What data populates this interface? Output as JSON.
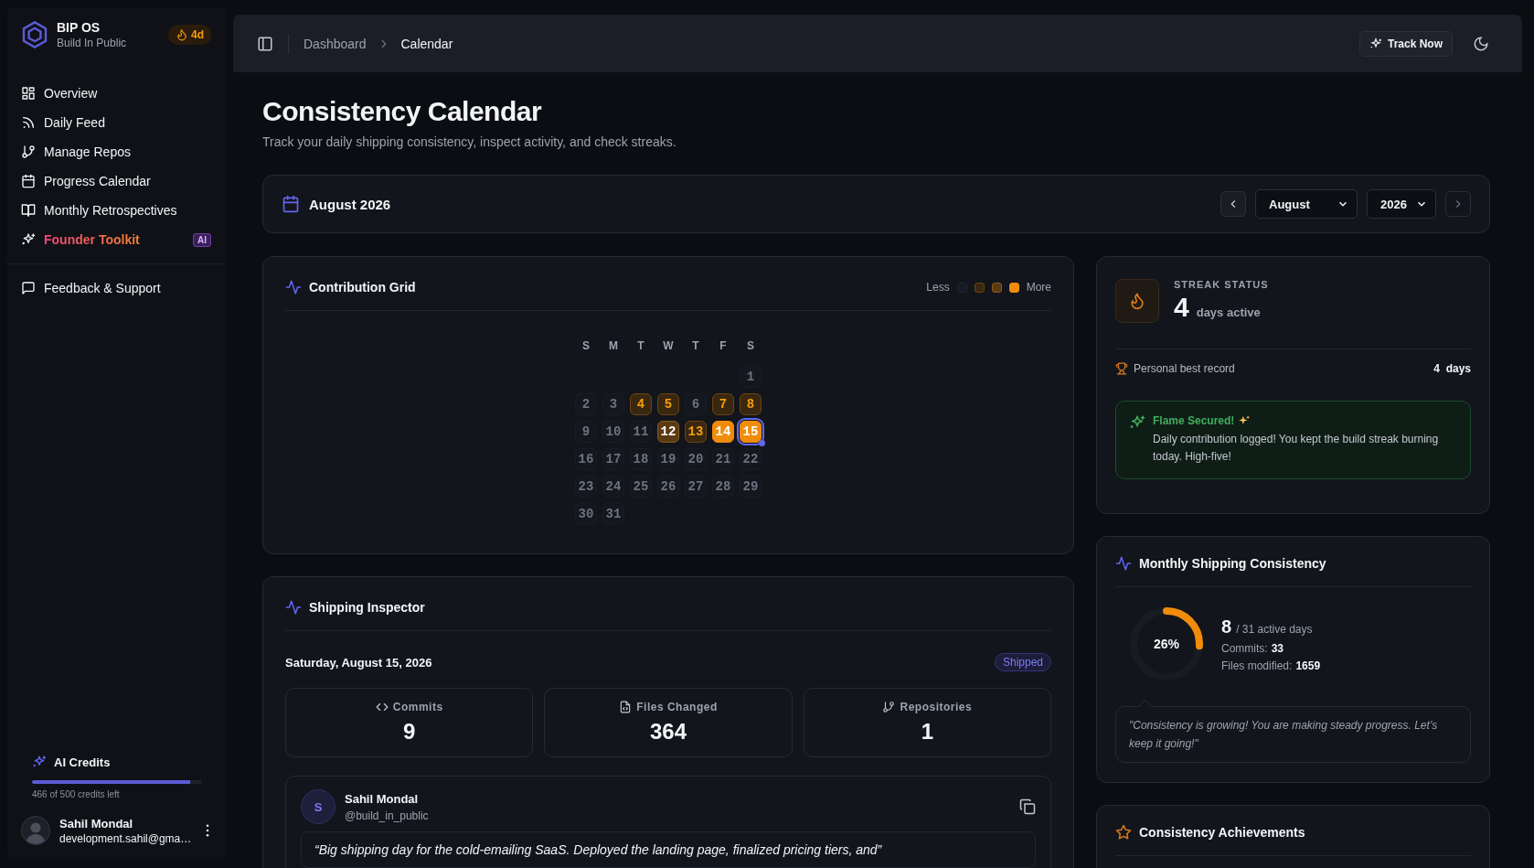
{
  "sidebar": {
    "brand": {
      "name": "BIP OS",
      "tagline": "Build In Public",
      "streak_badge": "4d"
    },
    "nav": [
      {
        "label": "Overview",
        "kind": "normal"
      },
      {
        "label": "Daily Feed",
        "kind": "normal"
      },
      {
        "label": "Manage Repos",
        "kind": "normal"
      },
      {
        "label": "Progress Calendar",
        "kind": "normal"
      },
      {
        "label": "Monthly Retrospectives",
        "kind": "normal"
      },
      {
        "label": "Founder Toolkit",
        "kind": "featured",
        "badge": "AI"
      }
    ],
    "footer_nav": [
      {
        "label": "Feedback & Support"
      }
    ],
    "credits": {
      "title": "AI Credits",
      "level": 0.932,
      "caption": "466 of 500 credits left"
    },
    "user": {
      "name": "Sahil Mondal",
      "email": "development.sahil@gma…"
    }
  },
  "header": {
    "breadcrumbs": [
      {
        "label": "Dashboard",
        "current": false
      },
      {
        "label": "Calendar",
        "current": true
      }
    ],
    "track_button": "Track Now"
  },
  "page": {
    "title": "Consistency Calendar",
    "subtitle": "Track your daily shipping consistency, inspect activity, and check streaks."
  },
  "month_bar": {
    "label": "August 2026",
    "month": "August",
    "year": "2026"
  },
  "contribution": {
    "title": "Contribution Grid",
    "legend": {
      "less": "Less",
      "more": "More",
      "swatches": [
        {
          "kind": "none"
        },
        {
          "kind": "low"
        },
        {
          "kind": "medium"
        },
        {
          "kind": "high"
        }
      ]
    },
    "weekdays": [
      "S",
      "M",
      "T",
      "W",
      "T",
      "F",
      "S"
    ],
    "weeks": [
      [
        {
          "day": "1",
          "kind": "none",
          "selected": false
        }
      ],
      [
        {
          "day": "2",
          "kind": "none",
          "selected": false
        },
        {
          "day": "3",
          "kind": "none",
          "selected": false
        },
        {
          "day": "4",
          "kind": "low",
          "selected": false
        },
        {
          "day": "5",
          "kind": "low",
          "selected": false
        },
        {
          "day": "6",
          "kind": "none",
          "selected": false
        },
        {
          "day": "7",
          "kind": "low",
          "selected": false
        },
        {
          "day": "8",
          "kind": "low",
          "selected": false
        }
      ],
      [
        {
          "day": "9",
          "kind": "none",
          "selected": false
        },
        {
          "day": "10",
          "kind": "none",
          "selected": false
        },
        {
          "day": "11",
          "kind": "none",
          "selected": false
        },
        {
          "day": "12",
          "kind": "medium",
          "selected": false
        },
        {
          "day": "13",
          "kind": "low",
          "selected": false
        },
        {
          "day": "14",
          "kind": "high",
          "selected": false
        },
        {
          "day": "15",
          "kind": "high",
          "selected": true
        }
      ],
      [
        {
          "day": "16",
          "kind": "none",
          "selected": false
        },
        {
          "day": "17",
          "kind": "none",
          "selected": false
        },
        {
          "day": "18",
          "kind": "none",
          "selected": false
        },
        {
          "day": "19",
          "kind": "none",
          "selected": false
        },
        {
          "day": "20",
          "kind": "none",
          "selected": false
        },
        {
          "day": "21",
          "kind": "none",
          "selected": false
        },
        {
          "day": "22",
          "kind": "none",
          "selected": false
        }
      ],
      [
        {
          "day": "23",
          "kind": "none",
          "selected": false
        },
        {
          "day": "24",
          "kind": "none",
          "selected": false
        },
        {
          "day": "25",
          "kind": "none",
          "selected": false
        },
        {
          "day": "26",
          "kind": "none",
          "selected": false
        },
        {
          "day": "27",
          "kind": "none",
          "selected": false
        },
        {
          "day": "28",
          "kind": "none",
          "selected": false
        },
        {
          "day": "29",
          "kind": "none",
          "selected": false
        }
      ],
      [
        {
          "day": "30",
          "kind": "none",
          "selected": false
        },
        {
          "day": "31",
          "kind": "none",
          "selected": false
        }
      ]
    ]
  },
  "inspector": {
    "title": "Shipping Inspector",
    "date": "Saturday, August 15, 2026",
    "status": "Shipped",
    "stats": [
      {
        "label": "Commits",
        "value": "9"
      },
      {
        "label": "Files Changed",
        "value": "364"
      },
      {
        "label": "Repositories",
        "value": "1"
      }
    ],
    "post": {
      "initial": "S",
      "name": "Sahil Mondal",
      "handle": "@build_in_public",
      "text": "“Big shipping day for the cold-emailing SaaS. Deployed the landing page, finalized pricing tiers, and”"
    }
  },
  "streak": {
    "label": "STREAK STATUS",
    "count": "4",
    "unit": "days active",
    "best_label": "Personal best record",
    "best_value": "4  days",
    "notice": {
      "title": "Flame Secured!",
      "text": "Daily contribution logged! You kept the build streak burning today. High-five!"
    }
  },
  "monthly": {
    "title": "Monthly Shipping Consistency",
    "level": 0.26,
    "percent": "26%",
    "active": "8",
    "active_suffix": "/ 31 active days",
    "commits_label": "Commits:",
    "commits": "33",
    "files_label": "Files modified:",
    "files": "1659",
    "quote": "\"Consistency is growing! You are making steady progress. Let's keep it going!\""
  },
  "achievements": {
    "title": "Consistency Achievements"
  }
}
